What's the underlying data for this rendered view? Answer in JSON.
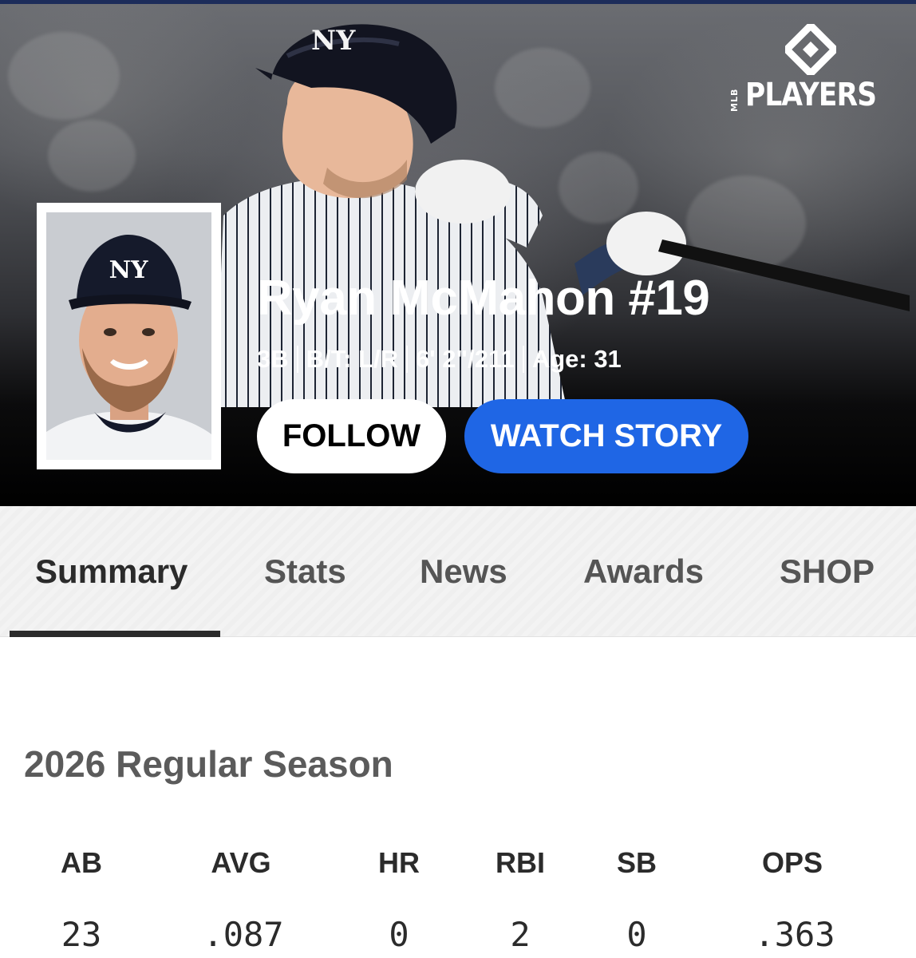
{
  "brand": {
    "small": "MLB",
    "name": "PLAYERS"
  },
  "player": {
    "name": "Ryan McMahon #19",
    "position": "3B",
    "bats_throws": "B/T: L/R",
    "height_weight": "6' 2\"/211",
    "age": "Age: 31",
    "cap_logo": "NY"
  },
  "actions": {
    "follow": "FOLLOW",
    "watch_story": "WATCH STORY"
  },
  "tabs": [
    {
      "label": "Summary",
      "active": true
    },
    {
      "label": "Stats"
    },
    {
      "label": "News"
    },
    {
      "label": "Awards"
    },
    {
      "label": "SHOP"
    }
  ],
  "season": {
    "title": "2026 Regular Season",
    "headers": [
      "AB",
      "AVG",
      "HR",
      "RBI",
      "SB",
      "OPS"
    ],
    "values": [
      "23",
      ".087",
      "0",
      "2",
      "0",
      ".363"
    ]
  },
  "colors": {
    "accent_blue": "#1f66e5",
    "hero_bg": "#000000",
    "text_dark": "#2b2b2b"
  },
  "icons": {
    "logo_mark": "diamond-logo-icon"
  }
}
